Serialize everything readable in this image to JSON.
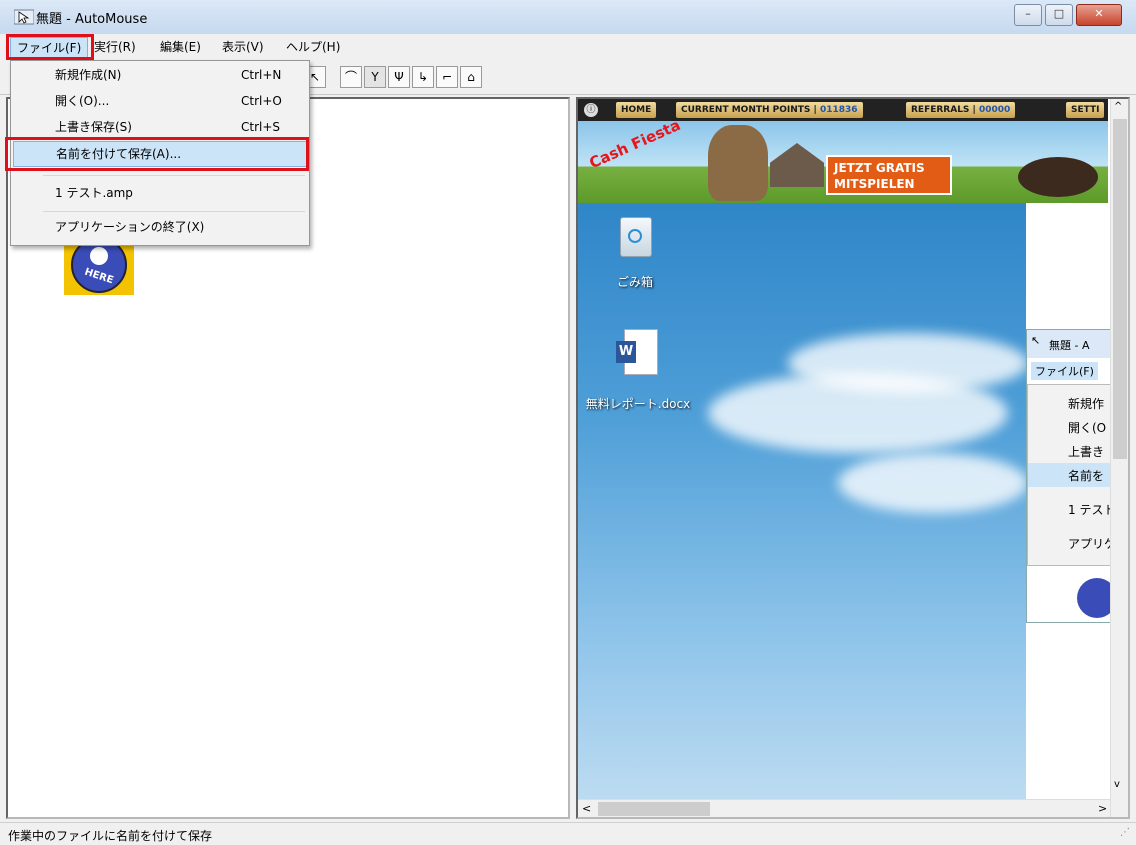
{
  "window": {
    "title": "無題 - AutoMouse",
    "minimize": "–",
    "maximize": "□",
    "close": "✕"
  },
  "menubar": {
    "items": [
      "ファイル(F)",
      "実行(R)",
      "編集(E)",
      "表示(V)",
      "ヘルプ(H)"
    ]
  },
  "file_menu": {
    "items": [
      {
        "label": "新規作成(N)",
        "shortcut": "Ctrl+N"
      },
      {
        "label": "開く(O)...",
        "shortcut": "Ctrl+O"
      },
      {
        "label": "上書き保存(S)",
        "shortcut": "Ctrl+S"
      },
      {
        "label": "名前を付けて保存(A)...",
        "shortcut": ""
      },
      {
        "label": "1 テスト.amp",
        "shortcut": ""
      },
      {
        "label": "アプリケーションの終了(X)",
        "shortcut": ""
      }
    ]
  },
  "toolbar": {
    "icons": [
      "click-icon",
      "move-line-icon",
      "drag-icon",
      "double-drag-icon",
      "curve-down-icon",
      "curve-up-icon",
      "mouse-icon"
    ]
  },
  "left_pane": {
    "start_icon_text": "HERE"
  },
  "embedded_screenshot": {
    "banner": {
      "home": "HOME",
      "points_label": "CURRENT MONTH POINTS",
      "points_value": "011836",
      "referrals_label": "REFERRALS",
      "referrals_value": "00000",
      "settings": "SETTI",
      "brand": "Cash Fiesta",
      "cta_line1": "JETZT GRATIS",
      "cta_line2": "MITSPIELEN"
    },
    "desktop_icons": [
      {
        "label": "ごみ箱"
      },
      {
        "label": "無料レポート.docx"
      }
    ],
    "inner_window": {
      "title": "無題 - A",
      "menu": "ファイル(F)",
      "items": [
        "新規作",
        "開く(O",
        "上書き",
        "名前を",
        "1 テスト",
        "アプリケ"
      ]
    }
  },
  "statusbar": {
    "text": "作業中のファイルに名前を付けて保存"
  },
  "colors": {
    "highlight": "#cce4f7",
    "annotation_red": "#e0101a"
  }
}
